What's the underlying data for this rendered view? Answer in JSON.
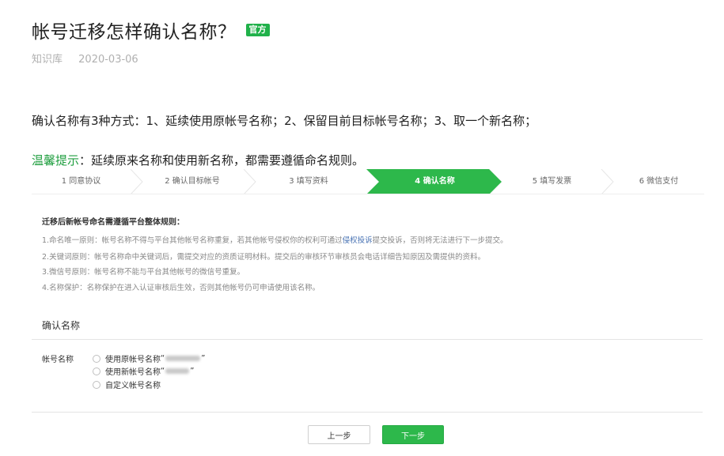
{
  "article": {
    "title": "帐号迁移怎样确认名称？",
    "badge": "官方",
    "category": "知识库",
    "date": "2020-03-06",
    "intro": "确认名称有3种方式：1、延续使用原帐号名称；2、保留目前目标帐号名称；3、取一个新名称；",
    "tip_label": "温馨提示",
    "tip_text": "：延续原来名称和使用新名称，都需要遵循命名规则。"
  },
  "steps": [
    {
      "label": "1 同意协议",
      "active": false
    },
    {
      "label": "2 确认目标帐号",
      "active": false
    },
    {
      "label": "3 填写资料",
      "active": false
    },
    {
      "label": "4 确认名称",
      "active": true
    },
    {
      "label": "5 填写发票",
      "active": false
    },
    {
      "label": "6 微信支付",
      "active": false
    }
  ],
  "colors": {
    "accent": "#2db84b",
    "badge": "#20b14a",
    "tip": "#1f9e3f",
    "link": "#4a74b4"
  },
  "rules": {
    "title": "迁移后新帐号命名需遵循平台整体规则：",
    "r1_before": "1.命名唯一原则：帐号名称不得与平台其他帐号名称重复，若其他帐号侵权你的权利可通过",
    "r1_link": "侵权投诉",
    "r1_after": "提交投诉，否则将无法进行下一步提交。",
    "r2": "2.关键词原则：帐号名称命中关键词后，需提交对应的资质证明材料。提交后的审核环节审核员会电话详细告知原因及需提供的资料。",
    "r3": "3.微信号原则：帐号名称不能与平台其他帐号的微信号重复。",
    "r4": "4.名称保护：名称保护在进入认证审核后生效，否则其他帐号仍可申请使用该名称。"
  },
  "confirm": {
    "section_title": "确认名称",
    "field_label": "帐号名称",
    "options": [
      {
        "label": "使用原帐号名称",
        "quote_open": "“",
        "quote_close": "”"
      },
      {
        "label": "使用新帐号名称",
        "quote_open": "“",
        "quote_close": "”"
      },
      {
        "label": "自定义帐号名称"
      }
    ],
    "prev_label": "上一步",
    "next_label": "下一步"
  }
}
